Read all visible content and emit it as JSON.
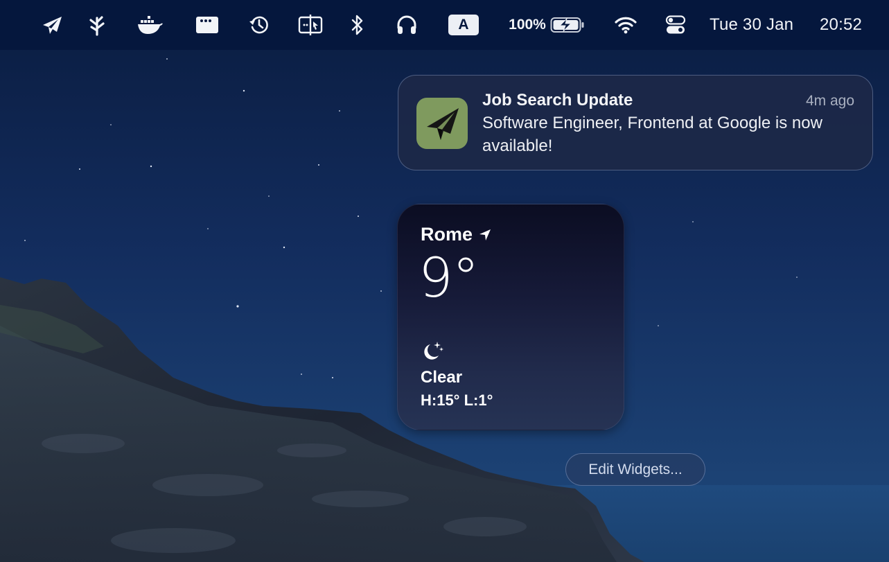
{
  "menubar": {
    "status_icons": [
      {
        "name": "paper-plane-icon"
      },
      {
        "name": "branch-icon"
      },
      {
        "name": "docker-icon"
      },
      {
        "name": "window-dots-icon"
      },
      {
        "name": "time-machine-icon"
      },
      {
        "name": "split-screen-icon"
      },
      {
        "name": "bluetooth-icon"
      },
      {
        "name": "headphones-icon"
      }
    ],
    "input_source": "A",
    "battery_percent": "100%",
    "battery_state": "charging",
    "date": "Tue 30 Jan",
    "time": "20:52"
  },
  "notification": {
    "app_icon": "paper-plane-icon",
    "app_icon_color": "#7f9a5e",
    "title": "Job Search Update",
    "time_ago": "4m ago",
    "body": "Software Engineer, Frontend at Google is now available!"
  },
  "weather_widget": {
    "city": "Rome",
    "location_icon": "location-arrow-icon",
    "temperature": "9°",
    "condition_icon": "moon-stars-icon",
    "condition": "Clear",
    "high_low": "H:15° L:1°"
  },
  "edit_widgets_button": {
    "label": "Edit Widgets..."
  }
}
